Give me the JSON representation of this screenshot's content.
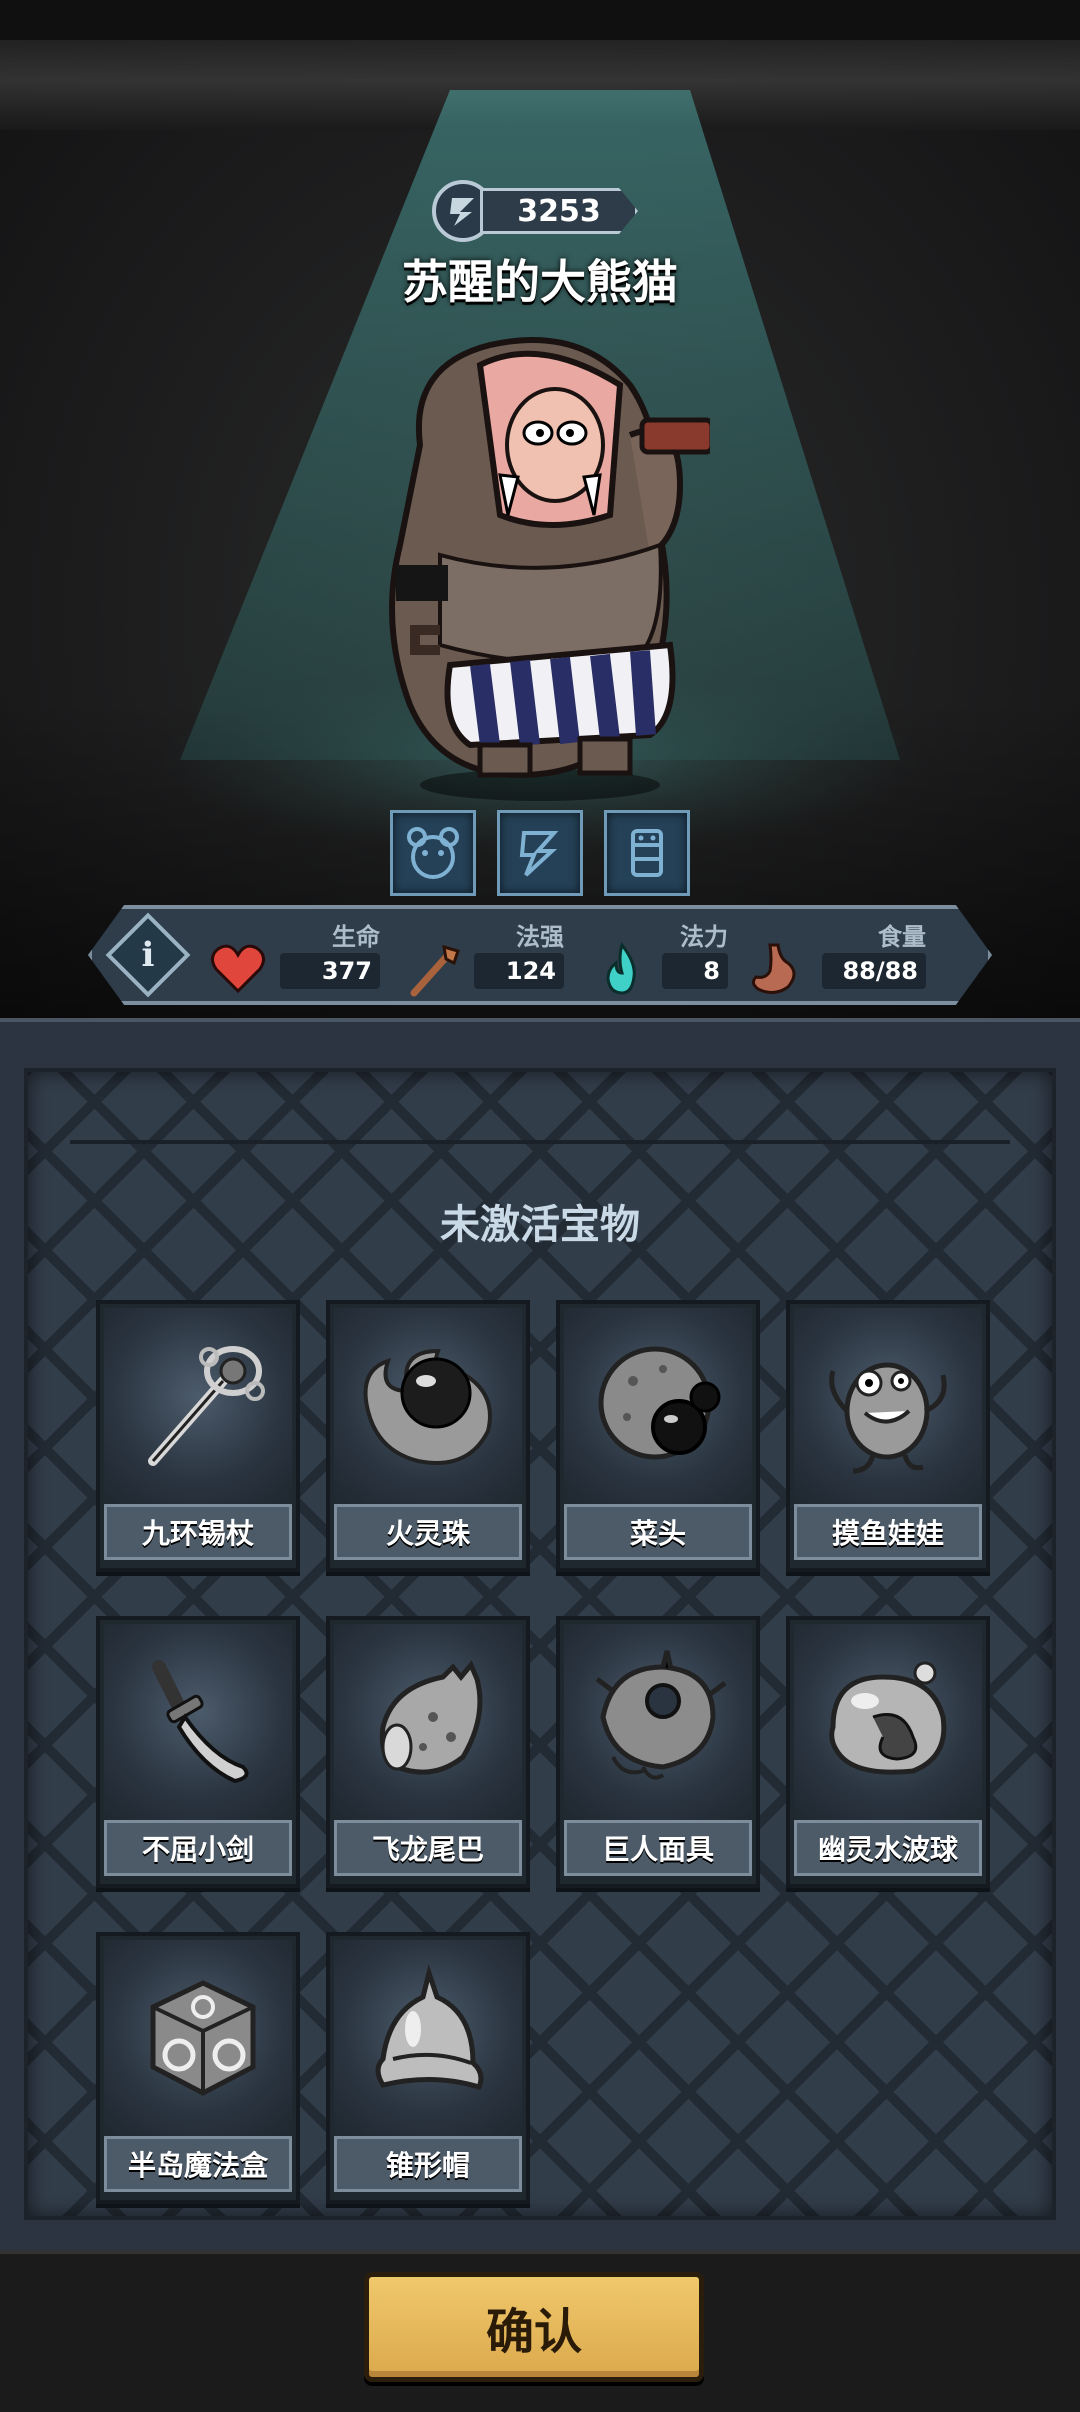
{
  "character": {
    "power": "3253",
    "name": "苏醒的大熊猫",
    "skills": [
      {
        "icon": "bear-head-icon"
      },
      {
        "icon": "lightning-icon"
      },
      {
        "icon": "totem-icon"
      }
    ]
  },
  "stats": [
    {
      "label": "生命",
      "value": "377",
      "icon": "heart-icon",
      "color": "#e0463c"
    },
    {
      "label": "法强",
      "value": "124",
      "icon": "staff-icon",
      "color": "#a8623c"
    },
    {
      "label": "法力",
      "value": "8",
      "icon": "mana-flame-icon",
      "color": "#3fd1c8"
    },
    {
      "label": "食量",
      "value": "88/88",
      "icon": "stomach-icon",
      "color": "#b86a52"
    }
  ],
  "panel": {
    "title": "未激活宝物",
    "treasures": [
      {
        "name": "九环锡杖",
        "icon": "ring-staff-icon"
      },
      {
        "name": "火灵珠",
        "icon": "fire-orb-icon"
      },
      {
        "name": "菜头",
        "icon": "spiked-ball-icon"
      },
      {
        "name": "摸鱼娃娃",
        "icon": "fish-doll-icon"
      },
      {
        "name": "不屈小剑",
        "icon": "short-sword-icon"
      },
      {
        "name": "飞龙尾巴",
        "icon": "dragon-tail-icon"
      },
      {
        "name": "巨人面具",
        "icon": "giant-mask-icon"
      },
      {
        "name": "幽灵水波球",
        "icon": "ghost-water-orb-icon"
      },
      {
        "name": "半岛魔法盒",
        "icon": "magic-box-icon"
      },
      {
        "name": "锥形帽",
        "icon": "cone-helmet-icon"
      }
    ]
  },
  "confirm_label": "确认"
}
